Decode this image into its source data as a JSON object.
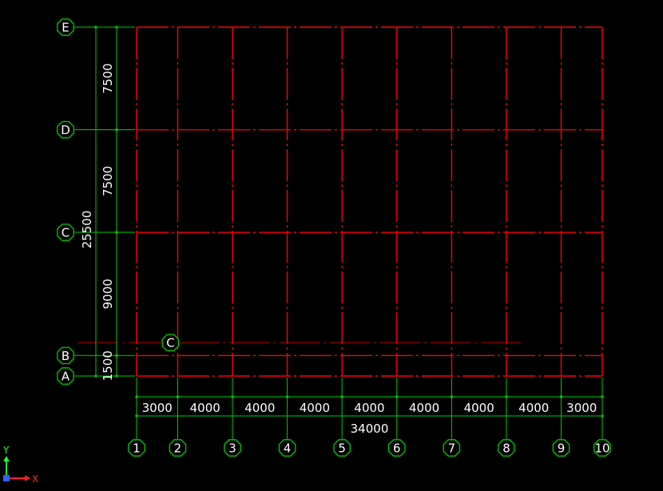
{
  "colors": {
    "background": "#000000",
    "grid_line": "#ff0000",
    "grid_line_dim": "#b30000",
    "dimension": "#00cc00",
    "bubble": "#00cc00",
    "text": "#ffffff",
    "axis_x": "#ff2020",
    "axis_y": "#20ff20",
    "origin": "#3060ff"
  },
  "grid": {
    "vertical_axes": [
      {
        "label": "1",
        "pos": 0
      },
      {
        "label": "2",
        "pos": 3000
      },
      {
        "label": "3",
        "pos": 7000
      },
      {
        "label": "4",
        "pos": 11000
      },
      {
        "label": "5",
        "pos": 15000
      },
      {
        "label": "6",
        "pos": 19000
      },
      {
        "label": "7",
        "pos": 23000
      },
      {
        "label": "8",
        "pos": 27000
      },
      {
        "label": "9",
        "pos": 31000
      },
      {
        "label": "10",
        "pos": 34000
      }
    ],
    "horizontal_axes": [
      {
        "label": "A",
        "pos": 0
      },
      {
        "label": "B",
        "pos": 1500
      },
      {
        "label": "C",
        "pos": 10500
      },
      {
        "label": "D",
        "pos": 18000
      },
      {
        "label": "E",
        "pos": 25500
      }
    ],
    "extra_axis": {
      "label": "C",
      "pos": 2500,
      "from": 3000,
      "to": 28000
    }
  },
  "dimensions": {
    "bottom_segments": [
      "3000",
      "4000",
      "4000",
      "4000",
      "4000",
      "4000",
      "4000",
      "4000",
      "3000"
    ],
    "bottom_total": "34000",
    "left_segments": [
      "1500",
      "9000",
      "7500",
      "7500"
    ],
    "left_total": "25500"
  },
  "ucs": {
    "x_label": "X",
    "y_label": "Y"
  }
}
